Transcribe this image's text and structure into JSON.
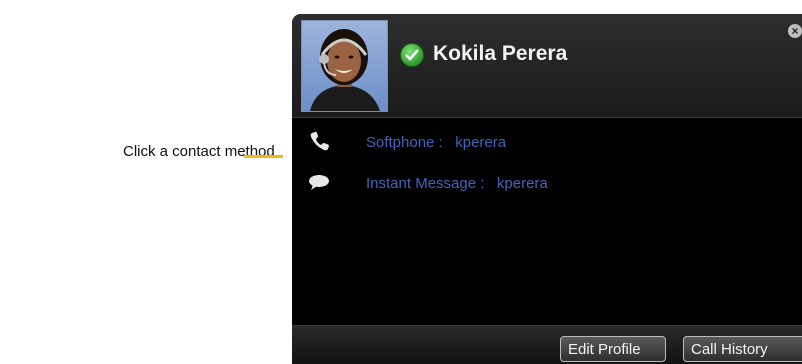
{
  "callout": {
    "text": "Click a contact method"
  },
  "contact": {
    "name": "Kokila Perera",
    "status_icon": "available-check-icon",
    "avatar_icon": "contact-photo"
  },
  "methods": [
    {
      "icon": "phone-icon",
      "label": "Softphone :   kperera"
    },
    {
      "icon": "chat-bubble-icon",
      "label": "Instant Message :   kperera"
    }
  ],
  "footer": {
    "edit_profile": "Edit Profile",
    "call_history": "Call History"
  },
  "colors": {
    "callout_line": "#f2b61c",
    "link_blue": "#3f64b8",
    "status_green": "#2e9a2a",
    "card_bg": "#000000"
  }
}
